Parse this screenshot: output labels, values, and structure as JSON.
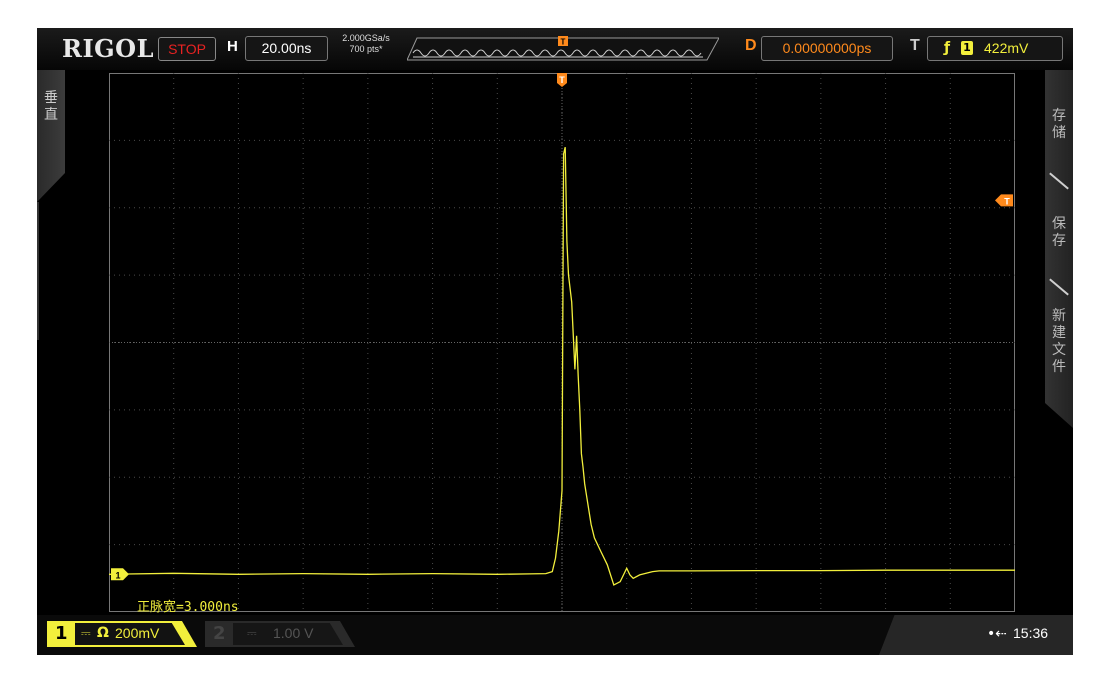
{
  "scope": {
    "brand": "RIGOL",
    "run_state": "STOP",
    "horizontal": {
      "label": "H",
      "timebase": "20.00ns"
    },
    "acquisition": {
      "sample_rate": "2.000GSa/s",
      "memory_depth": "700 pts*"
    },
    "delay": {
      "label": "D",
      "value": "0.00000000ps"
    },
    "trigger": {
      "label": "T",
      "edge": "rising-edge-icon",
      "edge_glyph": "ƒ",
      "source": "1",
      "level": "422mV"
    },
    "trigger_position_marker": "T",
    "trigger_level_marker": "T",
    "channel1_ground_marker": "1",
    "left_menu": {
      "label": "垂直"
    },
    "right_menu": {
      "items": [
        "存储",
        "保存",
        "新建文件"
      ]
    },
    "measurement": "正脉宽=3.000ns",
    "channels": [
      {
        "num": "1",
        "coupling_icon": "dc-coupling-icon",
        "coupling_glyph": "⎓",
        "impedance_glyph": "Ω",
        "scale": "200mV",
        "active": true
      },
      {
        "num": "2",
        "coupling_icon": "dc-coupling-icon",
        "coupling_glyph": "⎓",
        "scale": "1.00 V",
        "active": false
      }
    ],
    "status": {
      "usb_glyph": "•⇠",
      "time": "15:36"
    },
    "colors": {
      "ch1": "#f2ef3c",
      "trigger": "#ff8a1c",
      "stop": "#e82222",
      "grid": "#4a4a4a",
      "screen": "#000000"
    }
  },
  "chart_data": {
    "type": "line",
    "title": "",
    "xlabel": "",
    "ylabel": "",
    "xlim": [
      -140,
      140
    ],
    "ylim": [
      -800,
      800
    ],
    "x_unit": "ns",
    "y_unit": "mV",
    "grid": true,
    "divisions": {
      "x": 14,
      "y": 8
    },
    "series": [
      {
        "x": [
          -140,
          -120,
          -100,
          -80,
          -60,
          -40,
          -20,
          -10,
          -5,
          -3,
          -2,
          -1,
          0,
          0.5,
          1,
          1.5,
          2,
          3,
          4,
          4.5,
          5,
          5.5,
          6,
          6.5,
          7,
          8,
          9,
          10,
          12,
          14,
          16,
          18,
          19,
          20,
          21,
          22,
          24,
          26,
          28,
          30,
          40,
          60,
          80,
          100,
          120,
          140
        ],
        "values": [
          -688,
          -685,
          -688,
          -686,
          -688,
          -686,
          -688,
          -687,
          -686,
          -680,
          -640,
          -560,
          -440,
          560,
          580,
          300,
          200,
          120,
          -80,
          20,
          -100,
          -200,
          -330,
          -370,
          -420,
          -480,
          -540,
          -580,
          -620,
          -660,
          -720,
          -710,
          -690,
          -670,
          -690,
          -700,
          -690,
          -685,
          -680,
          -678,
          -678,
          -677,
          -677,
          -676,
          -676,
          -676
        ]
      }
    ]
  }
}
